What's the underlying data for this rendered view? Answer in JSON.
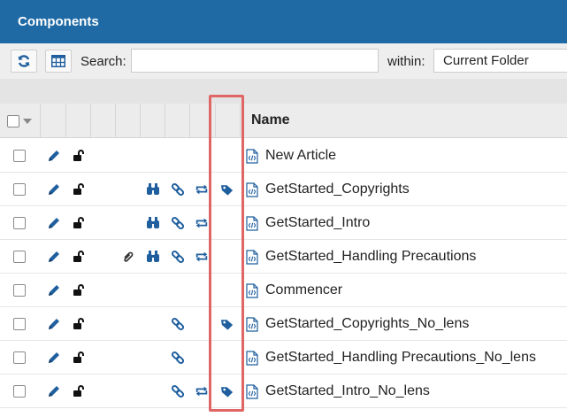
{
  "header": {
    "title": "Components"
  },
  "toolbar": {
    "refresh_icon": "refresh-icon",
    "grid_icon": "grid-view-icon",
    "search_label": "Search:",
    "search_value": "",
    "within_label": "within:",
    "within_value": "Current Folder"
  },
  "grid": {
    "name_header": "Name",
    "rows": [
      {
        "name": "New Article",
        "attachment": false,
        "binoculars": false,
        "link": false,
        "sync": false,
        "tag": false
      },
      {
        "name": "GetStarted_Copyrights",
        "attachment": false,
        "binoculars": true,
        "link": true,
        "sync": true,
        "tag": true
      },
      {
        "name": "GetStarted_Intro",
        "attachment": false,
        "binoculars": true,
        "link": true,
        "sync": true,
        "tag": false
      },
      {
        "name": "GetStarted_Handling Precautions",
        "attachment": true,
        "binoculars": true,
        "link": true,
        "sync": true,
        "tag": false
      },
      {
        "name": "Commencer",
        "attachment": false,
        "binoculars": false,
        "link": false,
        "sync": false,
        "tag": false
      },
      {
        "name": "GetStarted_Copyrights_No_lens",
        "attachment": false,
        "binoculars": false,
        "link": true,
        "sync": false,
        "tag": true
      },
      {
        "name": "GetStarted_Handling Precautions_No_lens",
        "attachment": false,
        "binoculars": false,
        "link": true,
        "sync": false,
        "tag": false
      },
      {
        "name": "GetStarted_Intro_No_lens",
        "attachment": false,
        "binoculars": false,
        "link": true,
        "sync": true,
        "tag": true
      }
    ]
  },
  "colors": {
    "accent": "#1f6aa5",
    "icon_blue": "#1f5f9e",
    "highlight": "#e06666"
  }
}
